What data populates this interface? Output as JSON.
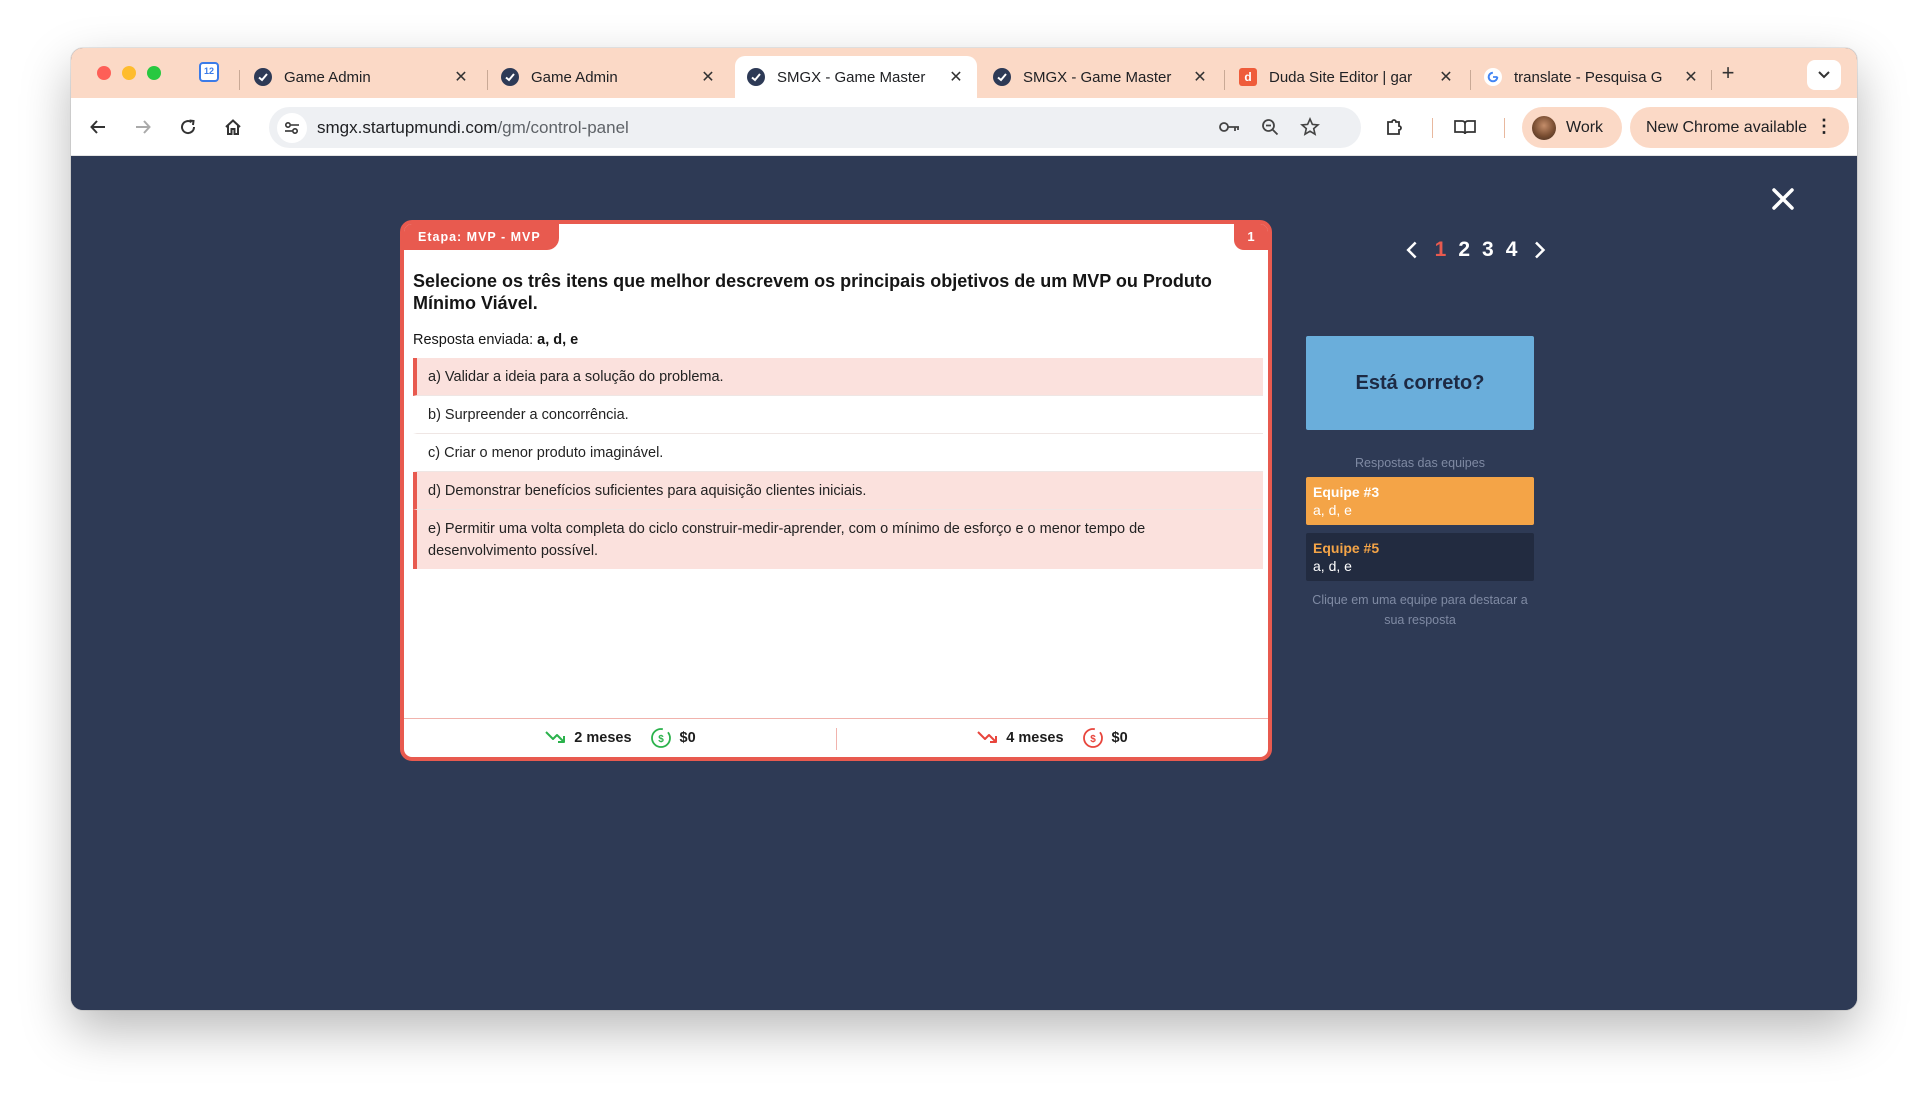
{
  "browser": {
    "pinned_tab_icon": "calendar-icon",
    "pinned_tab_label": "12",
    "tabs": [
      {
        "title": "Game Admin",
        "icon": "smgx-favicon",
        "active": false
      },
      {
        "title": "Game Admin",
        "icon": "smgx-favicon",
        "active": false
      },
      {
        "title": "SMGX - Game Master",
        "icon": "smgx-favicon",
        "active": true
      },
      {
        "title": "SMGX - Game Master",
        "icon": "smgx-favicon",
        "active": false
      },
      {
        "title": "Duda Site Editor | gar",
        "icon": "duda-favicon",
        "active": false
      },
      {
        "title": "translate - Pesquisa G",
        "icon": "google-favicon",
        "active": false
      }
    ],
    "new_tab": "+",
    "url_host": "smgx.startupmundi.com",
    "url_path": "/gm/control-panel",
    "profile_name": "Work",
    "update_label": "New Chrome available"
  },
  "colors": {
    "accent": "#e85a4f",
    "background": "#2e3a55",
    "check_button": "#6aaedb",
    "team_highlight": "#f4a447",
    "team_dark": "#222b40"
  },
  "card": {
    "stage": "Etapa: MVP - MVP",
    "number": "1",
    "question": "Selecione os três itens que melhor descrevem os principais objetivos de um MVP ou Produto Mínimo Viável.",
    "sent_label": "Resposta enviada: ",
    "sent_value": "a, d, e",
    "options": [
      {
        "text": "a) Validar a ideia para a solução do problema.",
        "selected": true
      },
      {
        "text": "b) Surpreender a concorrência.",
        "selected": false
      },
      {
        "text": "c) Criar o menor produto imaginável.",
        "selected": false
      },
      {
        "text": "d) Demonstrar benefícios suficientes para aquisição clientes iniciais.",
        "selected": true
      },
      {
        "text": "e) Permitir uma volta completa do ciclo construir-medir-aprender, com o mínimo de esforço e o menor tempo de desenvolvimento possível.",
        "selected": true
      }
    ],
    "footer": {
      "correct_time": "2 meses",
      "correct_money": "$0",
      "wrong_time": "4 meses",
      "wrong_money": "$0"
    }
  },
  "pager": {
    "pages": [
      "1",
      "2",
      "3",
      "4"
    ],
    "current": "1"
  },
  "side": {
    "check_label": "Está correto?",
    "answers_label": "Respostas das equipes",
    "teams": [
      {
        "name": "Equipe #3",
        "answer": "a, d, e"
      },
      {
        "name": "Equipe #5",
        "answer": "a, d, e"
      }
    ],
    "hint": "Clique em uma equipe para destacar a sua resposta"
  }
}
